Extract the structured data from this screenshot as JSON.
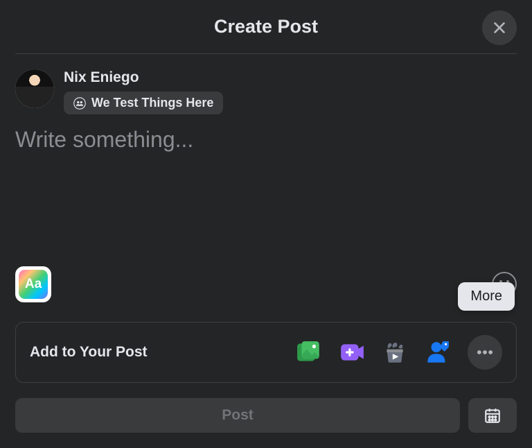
{
  "header": {
    "title": "Create Post"
  },
  "user": {
    "name": "Nix Eniego",
    "audience": "We Test Things Here"
  },
  "compose": {
    "placeholder": "Write something...",
    "bg_picker_label": "Aa"
  },
  "add_to_post": {
    "label": "Add to Your Post",
    "tooltip": "More"
  },
  "footer": {
    "post_label": "Post"
  },
  "icons": {
    "close": "close-icon",
    "group": "group-icon",
    "emoji": "emoji-icon",
    "photo": "photo-icon",
    "video": "live-video-icon",
    "popcorn": "watch-party-icon",
    "tag": "tag-people-icon",
    "more": "more-icon",
    "schedule": "schedule-icon"
  },
  "colors": {
    "photo": "#45bd62",
    "video": "#9360f7",
    "popcorn": "#6a7180",
    "tag": "#1877f2"
  }
}
